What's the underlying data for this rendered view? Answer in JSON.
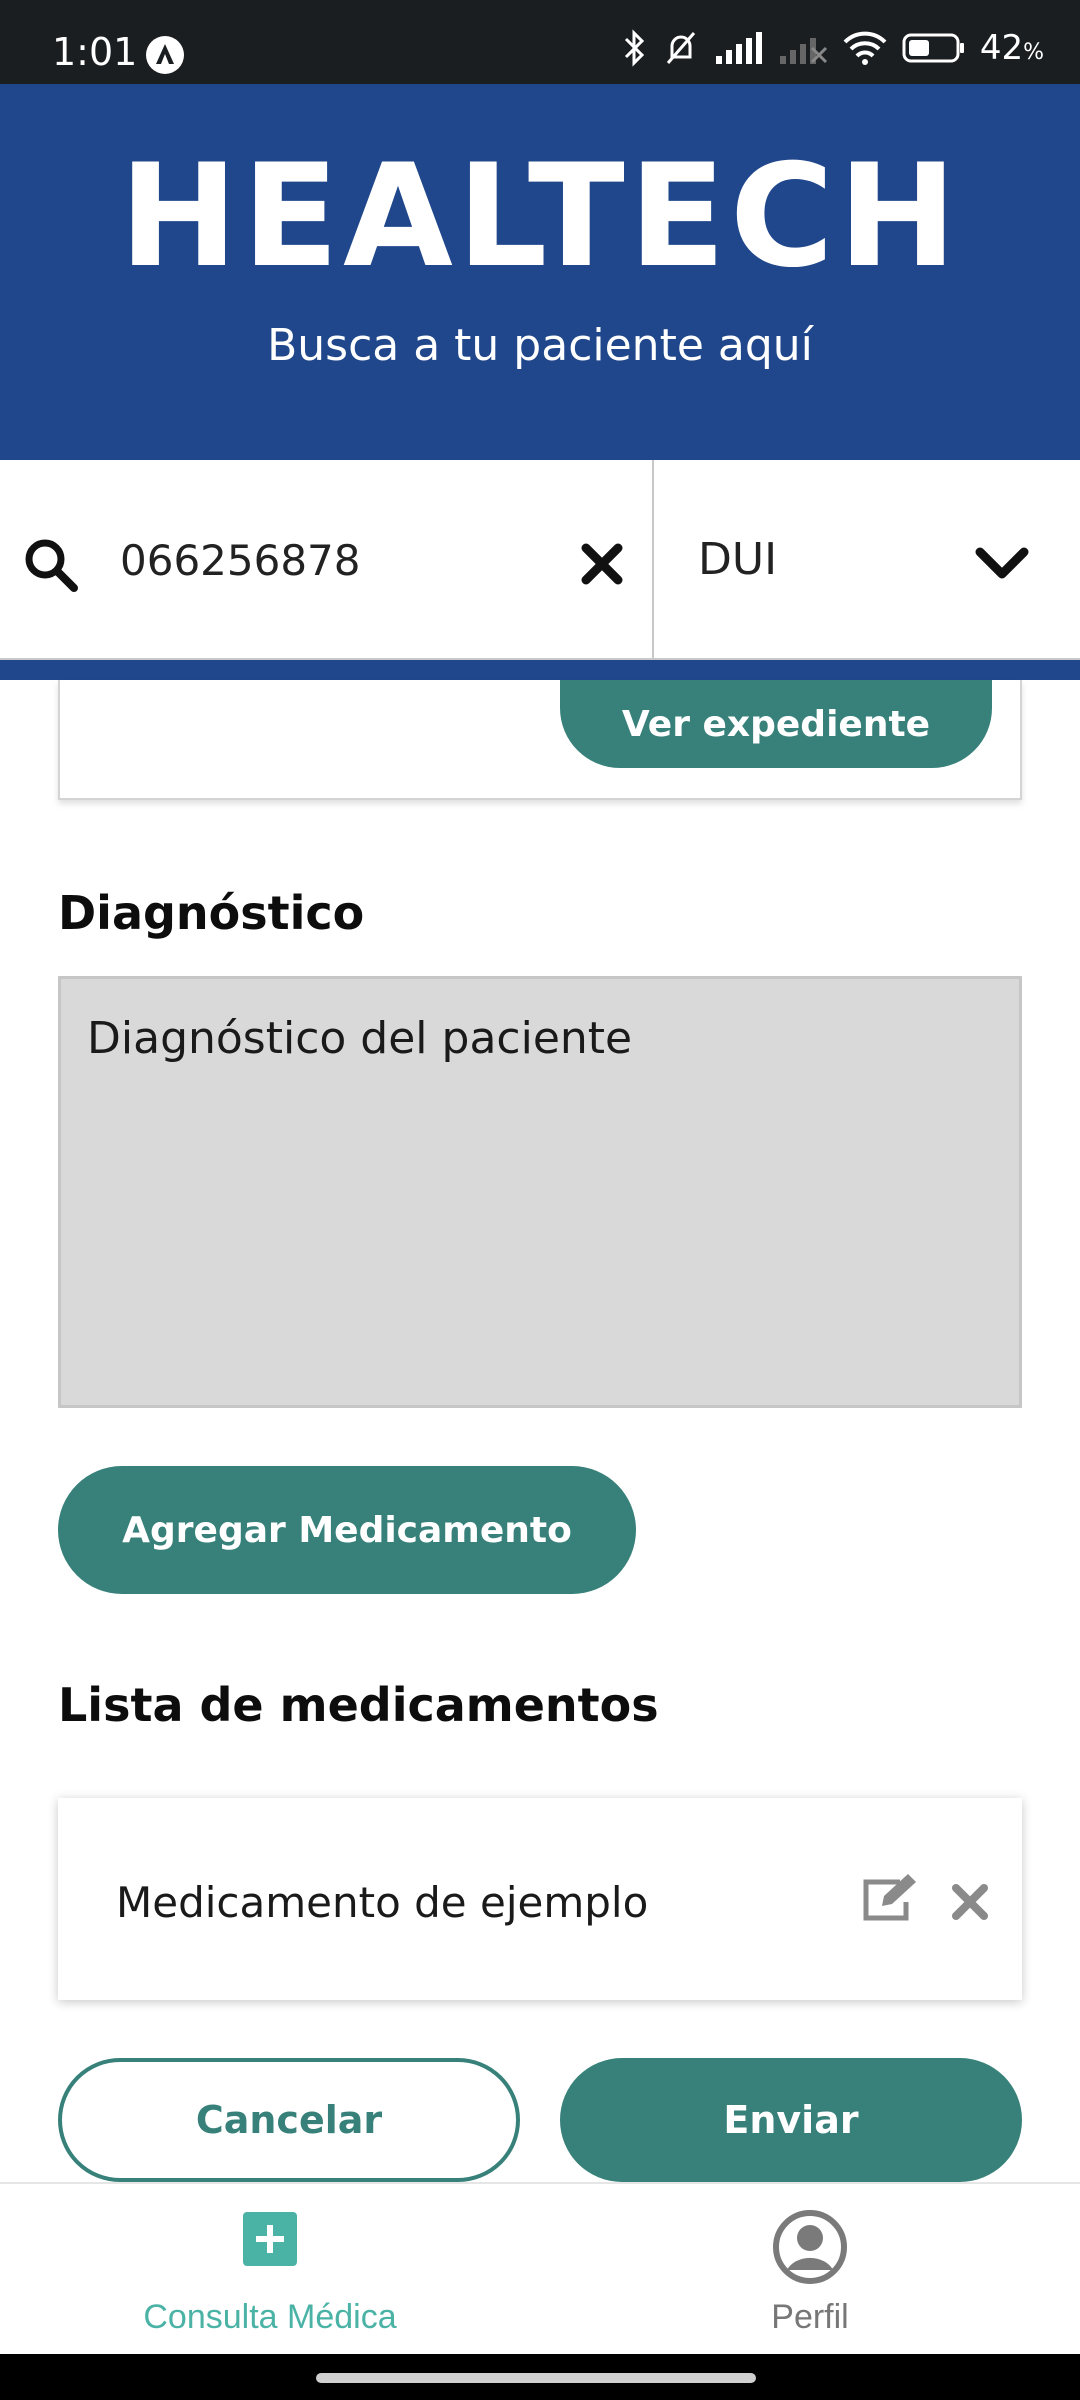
{
  "status_bar": {
    "time": "1:01",
    "battery_percent": "42",
    "battery_unit": "%"
  },
  "header": {
    "brand": "HEALTECH",
    "tagline": "Busca a tu paciente aquí"
  },
  "search": {
    "value": "066256878",
    "document_type": "DUI"
  },
  "patient_card": {
    "view_record_label": "Ver expediente"
  },
  "diagnosis": {
    "title": "Diagnóstico",
    "placeholder": "Diagnóstico del paciente"
  },
  "add_medication_label": "Agregar Medicamento",
  "medications": {
    "title": "Lista de medicamentos",
    "items": [
      {
        "name": "Medicamento de ejemplo"
      }
    ]
  },
  "actions": {
    "cancel_label": "Cancelar",
    "send_label": "Enviar"
  },
  "bottom_nav": {
    "items": [
      {
        "label": "Consulta Médica",
        "icon": "plus-square-icon",
        "active": true
      },
      {
        "label": "Perfil",
        "icon": "user-circle-icon",
        "active": false
      }
    ]
  },
  "colors": {
    "header_blue": "#20478b",
    "accent_teal": "#37817a",
    "nav_active": "#4bb3a6"
  }
}
